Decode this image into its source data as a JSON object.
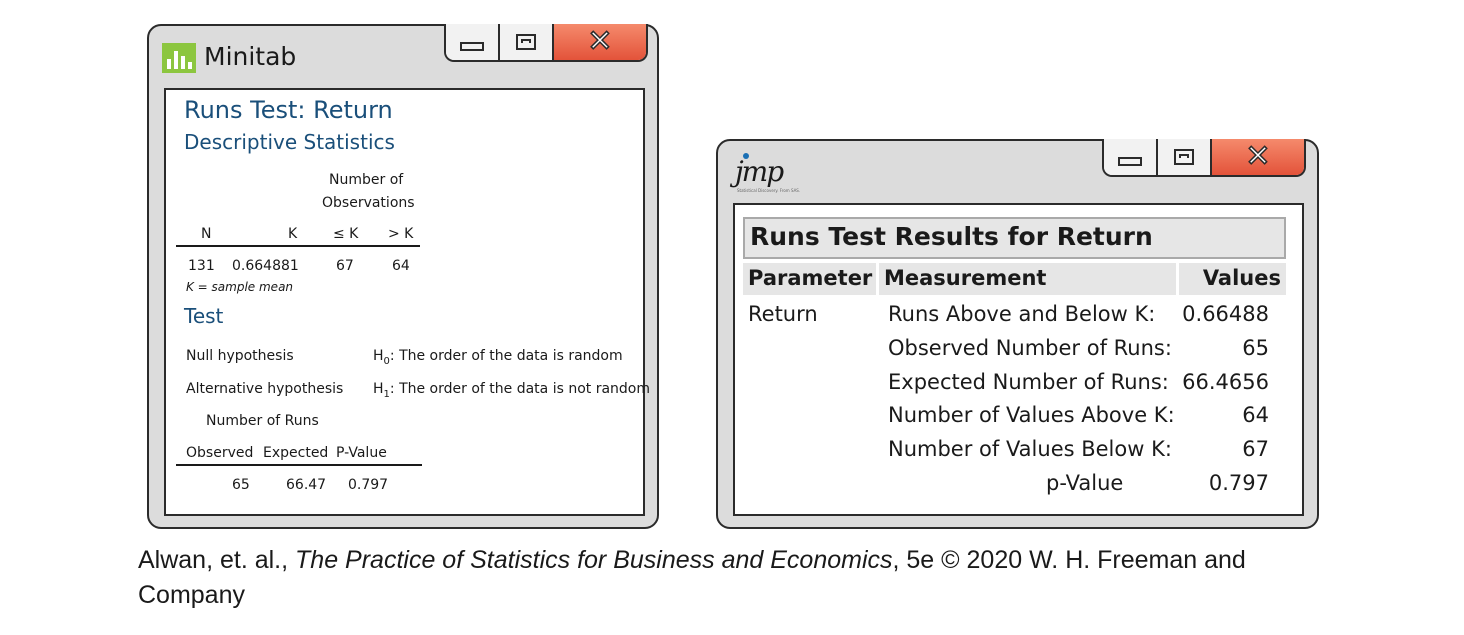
{
  "minitab": {
    "app_title": "Minitab",
    "heading": "Runs Test: Return",
    "subheading": "Descriptive Statistics",
    "group_header_line1": "Number of",
    "group_header_line2": "Observations",
    "columns": [
      "N",
      "K",
      "≤ K",
      "> K"
    ],
    "row": [
      "131",
      "0.664881",
      "67",
      "64"
    ],
    "note": "K = sample mean",
    "test_heading": "Test",
    "null_label": "Null hypothesis",
    "null_value": ": The order of the data is random",
    "alt_label": "Alternative hypothesis",
    "alt_value": ": The order of the data is not random",
    "h0": "H",
    "h0_sub": "0",
    "h1": "H",
    "h1_sub": "1",
    "runs_header": "Number of Runs",
    "runs_columns": [
      "Observed",
      "Expected",
      "P-Value"
    ],
    "runs_row": [
      "65",
      "66.47",
      "0.797"
    ]
  },
  "jmp": {
    "logo": "jmp",
    "tagline": "Statistical Discovery. From SAS.",
    "title": "Runs Test Results for Return",
    "columns": [
      "Parameter",
      "Measurement",
      "Values"
    ],
    "parameter": "Return",
    "rows": [
      {
        "measurement": "Runs Above and Below K:",
        "value": "0.66488"
      },
      {
        "measurement": "Observed Number of Runs:",
        "value": "65"
      },
      {
        "measurement": "Expected Number of Runs:",
        "value": "66.4656"
      },
      {
        "measurement": "Number of Values Above K:",
        "value": "64"
      },
      {
        "measurement": "Number of Values Below K:",
        "value": "67"
      },
      {
        "measurement": "p-Value",
        "value": "0.797"
      }
    ]
  },
  "window_controls": {
    "minimize": "minimize-icon",
    "maximize": "maximize-icon",
    "close": "close-icon"
  },
  "caption": {
    "prefix": "Alwan, et. al., ",
    "book": "The Practice of Statistics for Business and Economics",
    "suffix": ", 5e © 2020 W. H. Freeman and Company"
  }
}
